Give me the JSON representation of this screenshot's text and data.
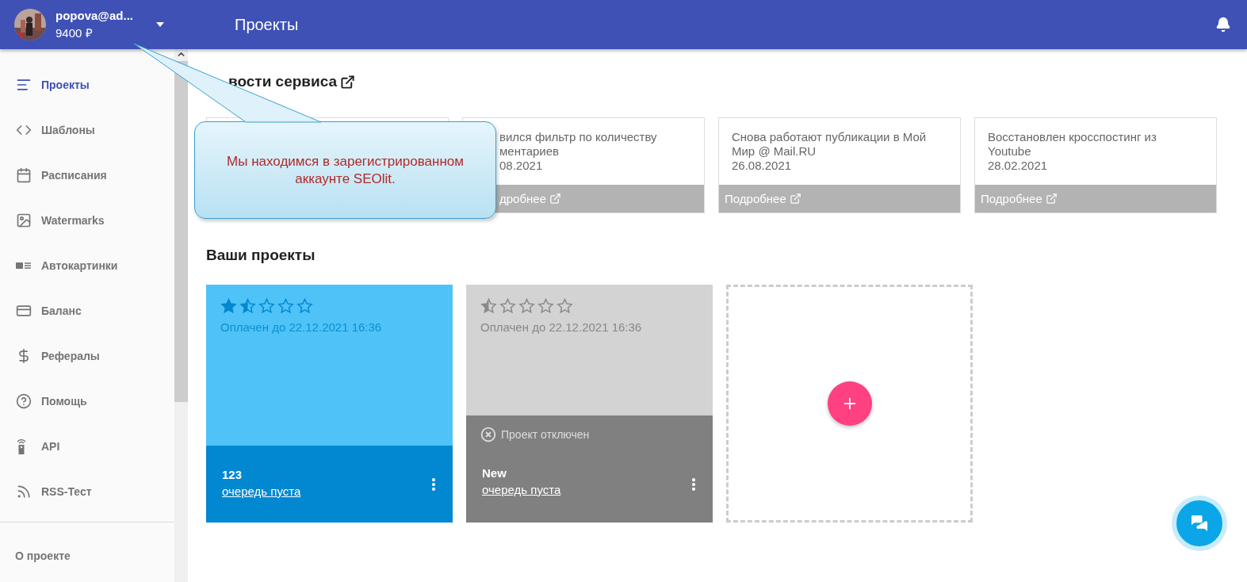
{
  "header": {
    "user_email": "popova@ad...",
    "balance": "9400 ₽",
    "title": "Проекты"
  },
  "sidebar": {
    "items": [
      {
        "label": "Проекты",
        "selected": true
      },
      {
        "label": "Шаблоны",
        "selected": false
      },
      {
        "label": "Расписания",
        "selected": false
      },
      {
        "label": "Watermarks",
        "selected": false
      },
      {
        "label": "Автокартинки",
        "selected": false
      },
      {
        "label": "Баланс",
        "selected": false
      },
      {
        "label": "Рефералы",
        "selected": false
      },
      {
        "label": "Помощь",
        "selected": false
      },
      {
        "label": "API",
        "selected": false
      },
      {
        "label": "RSS-Тест",
        "selected": false
      }
    ],
    "footer_link": "О проекте"
  },
  "news": {
    "heading": "вости сервиса",
    "items": [
      {
        "kind": "hidden"
      },
      {
        "kind": "partial",
        "lines": [
          "вился фильтр по количеству",
          "ментариев"
        ],
        "date": "08.2021",
        "link": "дробнее"
      },
      {
        "kind": "full",
        "lines": [
          "Снова работают публикации в Мой",
          "Мир @ Mail.RU"
        ],
        "date": "26.08.2021",
        "link": "Подробнее"
      },
      {
        "kind": "full",
        "lines": [
          "Восстановлен кросспостинг из",
          "Youtube"
        ],
        "date": "28.02.2021",
        "link": "Подробнее"
      }
    ]
  },
  "projects": {
    "heading": "Ваши проекты",
    "items": [
      {
        "name": "123",
        "stars": 1.5,
        "paid_until": "Оплачен до 22.12.2021 16:36",
        "queue": "очередь пуста",
        "disabled": false
      },
      {
        "name": "New",
        "stars": 0.5,
        "paid_until": "Оплачен до 22.12.2021 16:36",
        "queue": "очередь пуста",
        "disabled": true,
        "status": "Проект отключен"
      }
    ]
  },
  "callout": {
    "text": "Мы находимся в зарегистрированном аккаунте SEOlit."
  }
}
